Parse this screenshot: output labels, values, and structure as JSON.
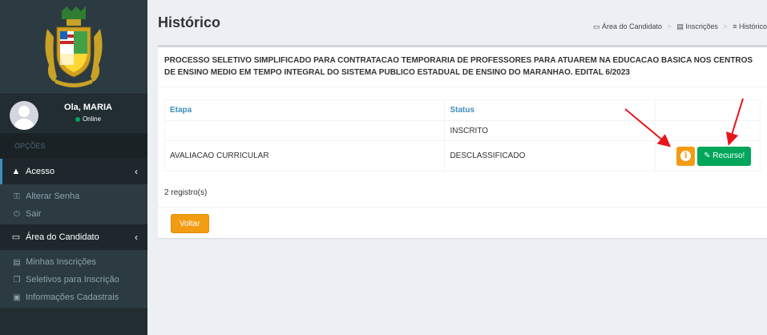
{
  "sidebar": {
    "user_greeting": "Ola, MARIA",
    "user_status": "Online",
    "section_header": "OPÇÕES",
    "menus": [
      {
        "label": "Acesso",
        "items": [
          "Alterar Senha",
          "Sair"
        ]
      },
      {
        "label": "Área do Candidato",
        "items": [
          "Minhas Inscrições",
          "Seletivos para Inscrição",
          "Informações Cadastrais"
        ]
      }
    ]
  },
  "header": {
    "title": "Histórico",
    "breadcrumb": [
      "Área do Candidato",
      "Inscrições",
      "Histórico"
    ]
  },
  "box": {
    "description": "PROCESSO SELETIVO SIMPLIFICADO PARA CONTRATACAO TEMPORARIA DE PROFESSORES PARA ATUAREM NA EDUCACAO BASICA NOS CENTROS DE ENSINO MEDIO EM TEMPO INTEGRAL DO SISTEMA PUBLICO ESTADUAL DE ENSINO DO MARANHAO. EDITAL 6/2023",
    "columns": [
      "Etapa",
      "Status",
      ""
    ],
    "rows": [
      {
        "etapa": "",
        "status": "INSCRITO"
      },
      {
        "etapa": "AVALIACAO CURRICULAR",
        "status": "DESCLASSIFICADO"
      }
    ],
    "info_button": "i",
    "recurso_button": "Recurso!",
    "record_count": "2 registro(s)",
    "back_button": "Voltar"
  },
  "colors": {
    "sidebar_bg": "#222d32",
    "accent_blue": "#3c8dbc",
    "orange": "#f39c12",
    "green": "#00a65a",
    "arrow_red": "#e8141b"
  }
}
